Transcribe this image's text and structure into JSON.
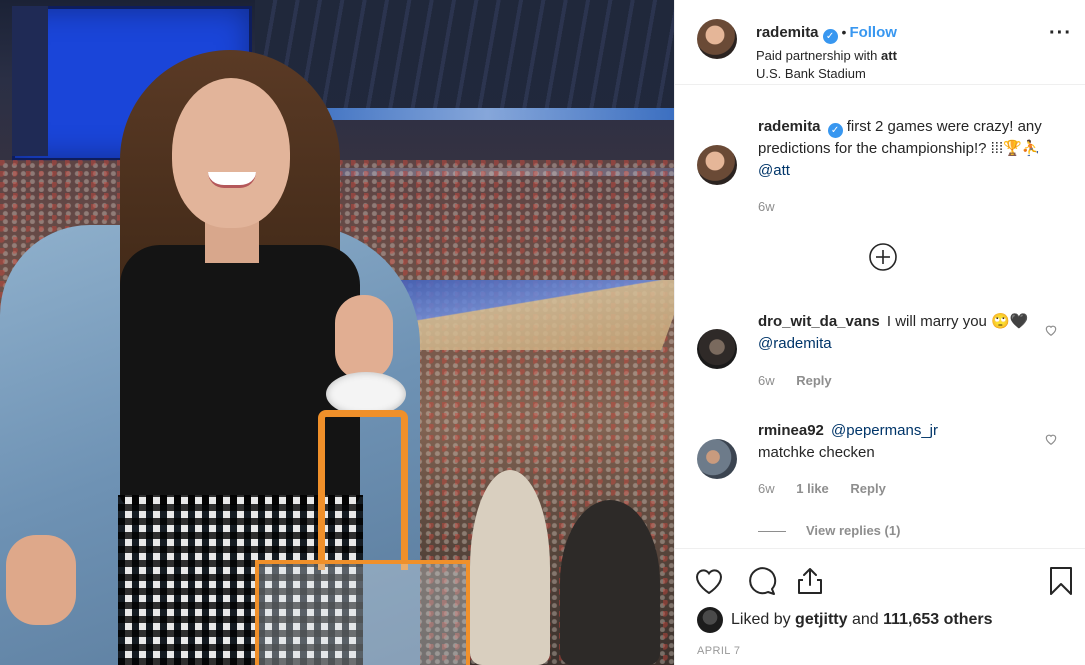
{
  "post": {
    "username": "rademita",
    "verified": true,
    "separator": "•",
    "follow_label": "Follow",
    "partnership_prefix": "Paid partnership with",
    "partner": "att",
    "location": "U.S. Bank Stadium",
    "more_icon": "more-options-icon"
  },
  "caption": {
    "username": "rademita",
    "text": "first 2 games were crazy! any predictions for the championship!? ⁞⁞⁞🏆⛹",
    "mention": "@att",
    "age": "6w"
  },
  "load_more_icon": "plus-circle-icon",
  "comments": [
    {
      "username": "dro_wit_da_vans",
      "text": "I will marry you 🙄🖤",
      "mention": "@rademita",
      "age": "6w",
      "likes": "",
      "reply_label": "Reply"
    },
    {
      "username": "rminea92",
      "mention": "@pepermans_jr",
      "text": "matchke checken",
      "age": "6w",
      "likes": "1 like",
      "reply_label": "Reply"
    }
  ],
  "view_replies": "View replies (1)",
  "actions": {
    "like_icon": "heart-icon",
    "comment_icon": "comment-icon",
    "share_icon": "share-icon",
    "save_icon": "bookmark-icon"
  },
  "likes": {
    "prefix": "Liked by",
    "user": "getjitty",
    "conjunction": "and",
    "count": "111,653 others"
  },
  "date": "APRIL 7",
  "colors": {
    "link_blue": "#3897f0",
    "mention_blue": "#003569",
    "muted_gray": "#8e8e8e",
    "text_dark": "#262626",
    "border": "#efefef"
  }
}
